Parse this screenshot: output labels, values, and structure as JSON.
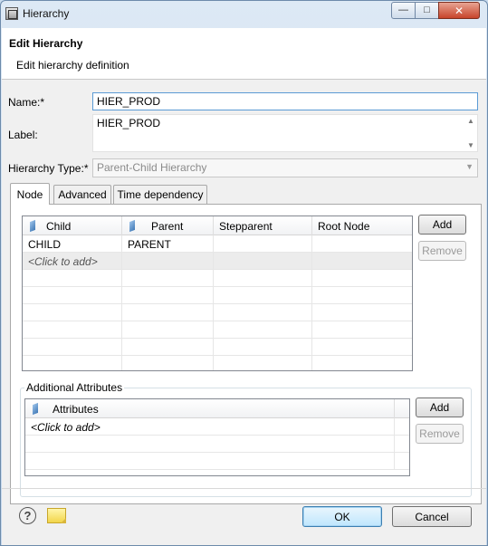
{
  "window": {
    "title": "Hierarchy",
    "controls": {
      "minimize": "—",
      "maximize": "□",
      "close": "✕"
    }
  },
  "header": {
    "title": "Edit Hierarchy",
    "subtitle": "Edit hierarchy definition"
  },
  "form": {
    "name_label": "Name:*",
    "name_value": "HIER_PROD",
    "label_label": "Label:",
    "label_value": "HIER_PROD",
    "type_label": "Hierarchy Type:*",
    "type_value": "Parent-Child Hierarchy"
  },
  "tabs": [
    {
      "label": "Node",
      "active": true
    },
    {
      "label": "Advanced",
      "active": false
    },
    {
      "label": "Time dependency",
      "active": false
    }
  ],
  "node_table": {
    "columns": [
      "Child",
      "Parent",
      "Stepparent",
      "Root Node"
    ],
    "rows": [
      [
        "CHILD",
        "PARENT",
        "",
        ""
      ]
    ],
    "add_row_text": "<Click to add>"
  },
  "node_buttons": {
    "add": "Add",
    "remove": "Remove"
  },
  "attributes": {
    "group_title": "Additional Attributes",
    "column": "Attributes",
    "add_row_text": "<Click to add>",
    "add": "Add",
    "remove": "Remove"
  },
  "footer": {
    "ok": "OK",
    "cancel": "Cancel",
    "help_glyph": "?"
  }
}
